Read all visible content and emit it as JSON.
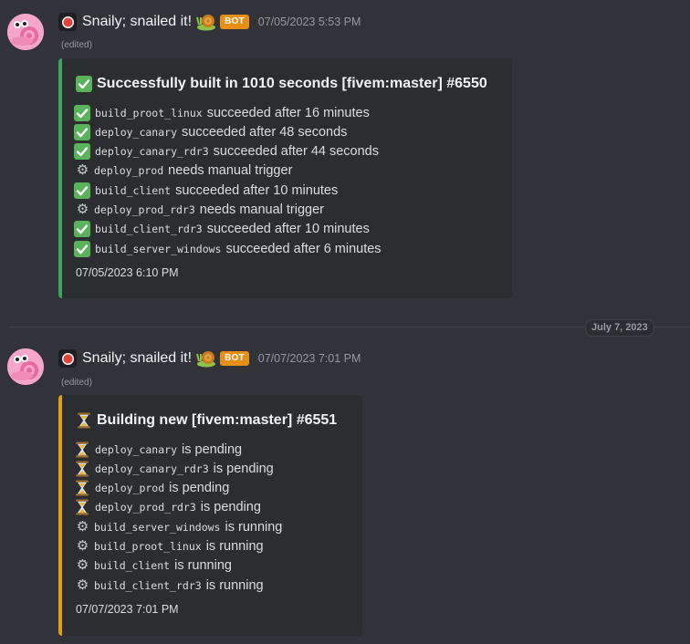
{
  "messages": [
    {
      "username": "Snaily; snailed it!",
      "badge": "BOT",
      "timestamp": "07/05/2023 5:53 PM",
      "edited": "(edited)",
      "embed": {
        "status": "success",
        "title": "Successfully built in 1010 seconds [fivem:master] #6550",
        "lines": [
          {
            "icon": "check",
            "job": "build_proot_linux",
            "text": "succeeded after 16 minutes"
          },
          {
            "icon": "check",
            "job": "deploy_canary",
            "text": "succeeded after 48 seconds"
          },
          {
            "icon": "check",
            "job": "deploy_canary_rdr3",
            "text": "succeeded after 44 seconds"
          },
          {
            "icon": "gear",
            "job": "deploy_prod",
            "text": "needs manual trigger"
          },
          {
            "icon": "check",
            "job": "build_client",
            "text": "succeeded after 10 minutes"
          },
          {
            "icon": "gear",
            "job": "deploy_prod_rdr3",
            "text": "needs manual trigger"
          },
          {
            "icon": "check",
            "job": "build_client_rdr3",
            "text": "succeeded after 10 minutes"
          },
          {
            "icon": "check",
            "job": "build_server_windows",
            "text": "succeeded after 6 minutes"
          }
        ],
        "footer": "07/05/2023 6:10 PM"
      }
    },
    {
      "username": "Snaily; snailed it!",
      "badge": "BOT",
      "timestamp": "07/07/2023 7:01 PM",
      "edited": "(edited)",
      "embed": {
        "status": "pending",
        "title": "Building new [fivem:master] #6551",
        "lines": [
          {
            "icon": "hourglass",
            "job": "deploy_canary",
            "text": "is pending"
          },
          {
            "icon": "hourglass",
            "job": "deploy_canary_rdr3",
            "text": "is pending"
          },
          {
            "icon": "hourglass",
            "job": "deploy_prod",
            "text": "is pending"
          },
          {
            "icon": "hourglass",
            "job": "deploy_prod_rdr3",
            "text": "is pending"
          },
          {
            "icon": "gear",
            "job": "build_server_windows",
            "text": "is running"
          },
          {
            "icon": "gear",
            "job": "build_proot_linux",
            "text": "is running"
          },
          {
            "icon": "gear",
            "job": "build_client",
            "text": "is running"
          },
          {
            "icon": "gear",
            "job": "build_client_rdr3",
            "text": "is running"
          }
        ],
        "footer": "07/07/2023 7:01 PM"
      }
    }
  ],
  "date_divider": "July 7, 2023",
  "colors": {
    "background": "#313338",
    "embed_bg": "#2b2d31",
    "success_bar": "#3ba55d",
    "pending_bar": "#e0a10f",
    "bot_badge": "#e68f14",
    "check_green": "#59b35a"
  }
}
